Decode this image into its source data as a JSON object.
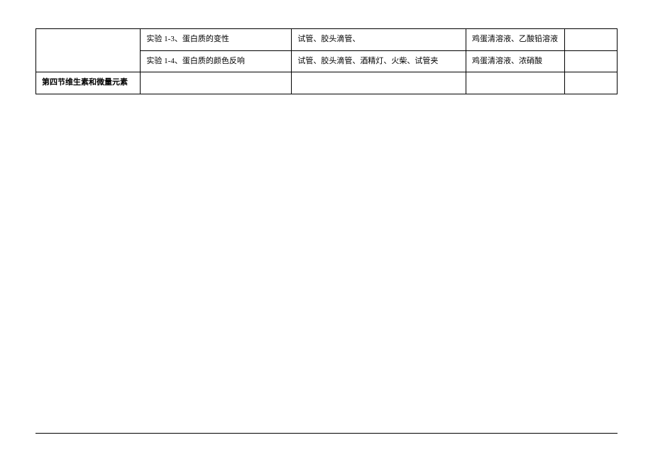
{
  "table": {
    "rows": [
      {
        "col1": "",
        "col2": "实验 1-3、蛋白质的变性",
        "col3": "试管、胶头滴管、",
        "col4": "鸡蛋清溶液、乙酸铅溶液",
        "col5": ""
      },
      {
        "col1": "",
        "col2": "实验 1-4、蛋白质的颜色反响",
        "col3": "试管、胶头滴管、酒精灯、火柴、试管夹",
        "col4": "鸡蛋清溶液、浓硝酸",
        "col5": ""
      },
      {
        "col1": "第四节维生素和微量元素",
        "col2": "",
        "col3": "",
        "col4": "",
        "col5": ""
      }
    ]
  }
}
